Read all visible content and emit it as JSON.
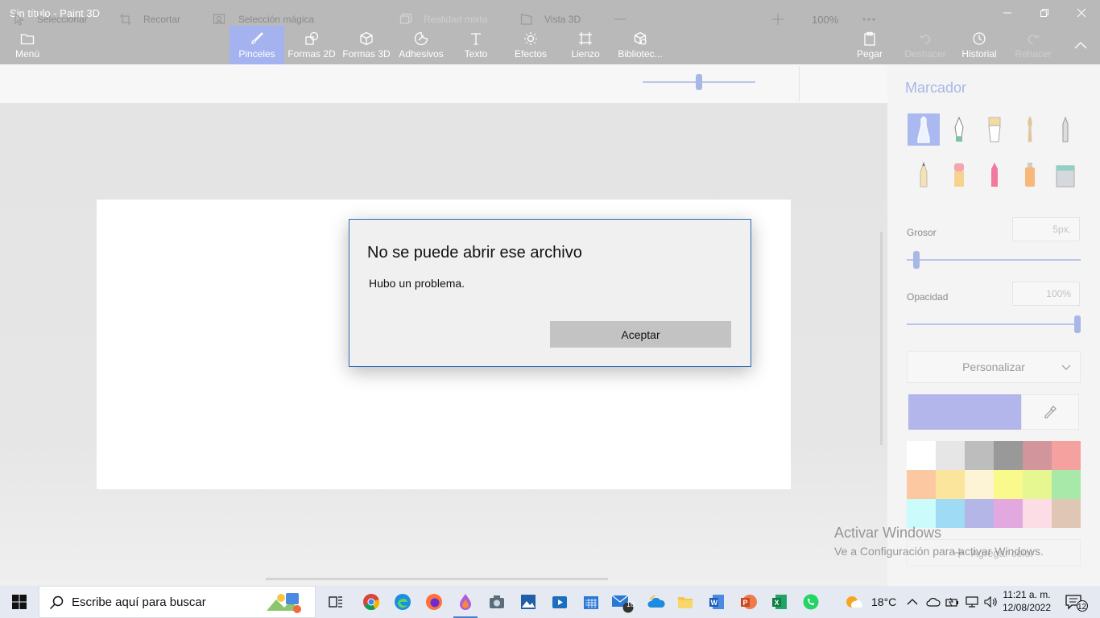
{
  "window": {
    "title": "Sin título - Paint 3D"
  },
  "ribbon": {
    "menu_label": "Menú",
    "tools": [
      {
        "label": "Pinceles",
        "icon": "brush-icon",
        "active": true
      },
      {
        "label": "Formas 2D",
        "icon": "shapes-2d-icon"
      },
      {
        "label": "Formas 3D",
        "icon": "cube-icon"
      },
      {
        "label": "Adhesivos",
        "icon": "sticker-icon"
      },
      {
        "label": "Texto",
        "icon": "text-icon"
      },
      {
        "label": "Efectos",
        "icon": "sun-icon"
      },
      {
        "label": "Lienzo",
        "icon": "canvas-icon"
      },
      {
        "label": "Bibliotec...",
        "icon": "library-icon"
      }
    ],
    "paste_label": "Pegar",
    "undo_label": "Deshacer",
    "history_label": "Historial",
    "redo_label": "Rehacer"
  },
  "subtoolbar": {
    "select_label": "Seleccionar",
    "crop_label": "Recortar",
    "magic_select_label": "Selección mágica",
    "mixed_reality_label": "Realidad mixta",
    "view3d_label": "Vista 3D",
    "zoom_label": "100%",
    "zoom_value": 0.5
  },
  "panel": {
    "title": "Marcador",
    "brushes": [
      "marker-icon",
      "calligraphy-pen-icon",
      "oil-brush-icon",
      "watercolor-icon",
      "pixel-pen-icon",
      "pencil-icon",
      "eraser-icon",
      "crayon-icon",
      "spray-can-icon",
      "fill-bucket-icon"
    ],
    "thickness_label": "Grosor",
    "thickness_value": "5px.",
    "opacity_label": "Opacidad",
    "opacity_value": "100%",
    "customize_label": "Personalizar",
    "current_color": "#b2b6ea",
    "palette": [
      "#ffffff",
      "#e6e6e6",
      "#bdbdbd",
      "#999999",
      "#d2959c",
      "#f4a1a0",
      "#fcc8a2",
      "#fbe49c",
      "#fdf4d5",
      "#f9f98c",
      "#e6f792",
      "#a8e8a8",
      "#cbfbfb",
      "#9fdbf4",
      "#b3b6e6",
      "#e1a9df",
      "#fcdde5",
      "#e0c7b5"
    ],
    "add_color_label": "Agregar color"
  },
  "dialog": {
    "title": "No se puede abrir ese archivo",
    "message": "Hubo un problema.",
    "ok_label": "Aceptar"
  },
  "watermark": {
    "line1": "Activar Windows",
    "line2": "Ve a Configuración para activar Windows."
  },
  "taskbar": {
    "search_placeholder": "Escribe aquí para buscar",
    "mail_badge": "10",
    "weather": "18°C",
    "time": "11:21 a. m.",
    "date": "12/08/2022",
    "notifications": "12"
  }
}
